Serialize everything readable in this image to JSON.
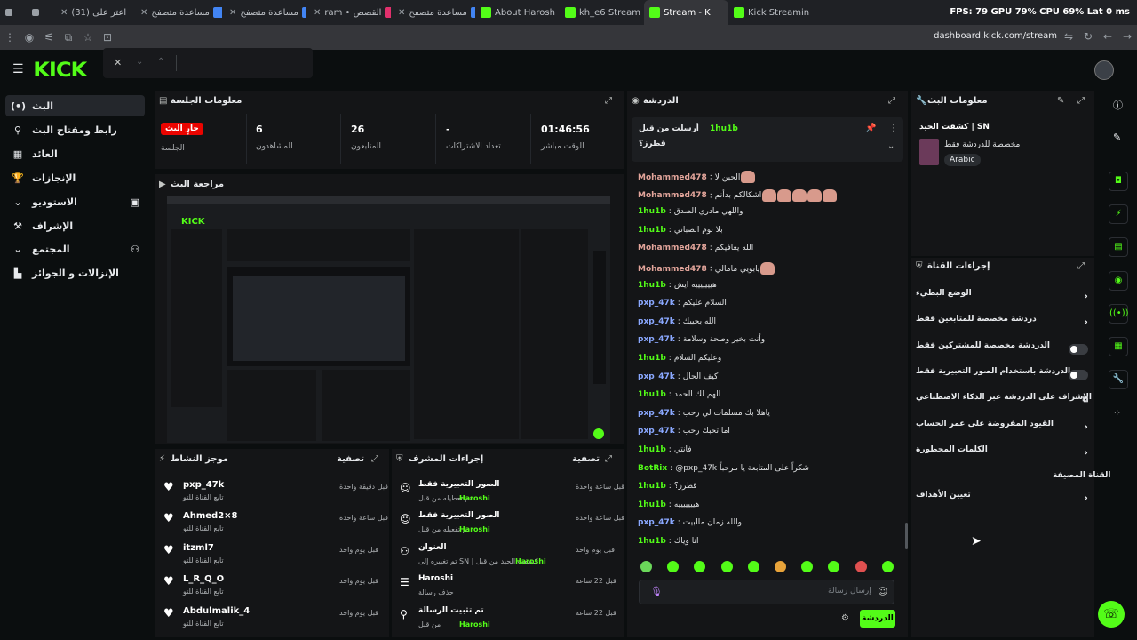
{
  "browser": {
    "tabs": [
      {
        "label": "",
        "icon": "#9aa0a6"
      },
      {
        "label": "",
        "icon": "#9aa0a6"
      },
      {
        "label": "(31) اعتر على",
        "icon": "#9aa0a6"
      },
      {
        "label": "مساعدة متصفح",
        "icon": "#4285f4"
      },
      {
        "label": "مساعدة متصفح",
        "icon": "#4285f4"
      },
      {
        "label": "ram • القصص",
        "icon": "#e1306c"
      },
      {
        "label": "مساعدة متصفح",
        "icon": "#4285f4"
      },
      {
        "label": "About Harosh",
        "icon": "#53fc18"
      },
      {
        "label": "kh_e6 Stream",
        "icon": "#53fc18"
      },
      {
        "label": "Stream - K",
        "icon": "#53fc18"
      },
      {
        "label": "Kick Streamin",
        "icon": "#53fc18"
      }
    ],
    "overlay": "FPS: 79  GPU 79%  CPU 69%  Lat 0 ms",
    "url": "dashboard.kick.com/stream"
  },
  "logo": "KICK",
  "sidebar": {
    "items": [
      {
        "label": "البث",
        "icon": "(•)"
      },
      {
        "label": "رابط ومفتاح البث",
        "icon": "⚲"
      },
      {
        "label": "العائد",
        "icon": "▦"
      },
      {
        "label": "الإنجازات",
        "icon": "🏆"
      },
      {
        "label": "الاستوديو",
        "icon": "⌄"
      },
      {
        "label": "الإشراف",
        "icon": "⚒"
      },
      {
        "label": "المجتمع",
        "icon": "⌄"
      },
      {
        "label": "الإنزالات و الجوائز",
        "icon": "▙"
      }
    ]
  },
  "session": {
    "title": "معلومات الجلسة",
    "live_badge": "جارٍ البث",
    "live_label": "الجلسة",
    "stats": [
      {
        "value": "6",
        "label": "المشاهدون"
      },
      {
        "value": "26",
        "label": "المتابعون"
      },
      {
        "value": "-",
        "label": "تعداد الاشتراكات"
      },
      {
        "value": "01:46:56",
        "label": "الوقت مباشر"
      }
    ]
  },
  "preview": {
    "title": "مراجعة البث"
  },
  "activity": {
    "title": "موجز النشاط",
    "filter": "تصفية",
    "items": [
      {
        "name": "pxp_47k",
        "sub": "تابع القناة للتو",
        "time": "قبل دقيقة واحدة"
      },
      {
        "name": "Ahmed2×8",
        "sub": "تابع القناة للتو",
        "time": "قبل ساعة واحدة"
      },
      {
        "name": "itzml7",
        "sub": "تابع القناة للتو",
        "time": "قبل يوم واحد"
      },
      {
        "name": "L_R_Q_O",
        "sub": "تابع القناة للتو",
        "time": "قبل يوم واحد"
      },
      {
        "name": "Abdulmalik_4",
        "sub": "تابع القناة للتو",
        "time": "قبل يوم واحد"
      }
    ]
  },
  "modactions": {
    "title": "إجراءات المشرف",
    "filter": "تصفية",
    "items": [
      {
        "name": "الصور التعبيرية فقط",
        "sub": "تم تعطيله من قبل",
        "user": "Haroshi",
        "time": "قبل ساعة واحدة"
      },
      {
        "name": "الصور التعبيرية فقط",
        "sub": "تم تفعيله من قبل",
        "user": "Haroshi",
        "time": "قبل ساعة واحدة"
      },
      {
        "name": "العنوان",
        "sub": "تم تغييره إلى SN | كشفت الحيد من قبل",
        "user": "Haroshi",
        "time": "قبل يوم واحد"
      },
      {
        "name": "Haroshi",
        "sub": "حذف رسالة",
        "user": "",
        "time": "قبل 22 ساعة"
      },
      {
        "name": "تم تثبيت الرسالة",
        "sub": "من قبل",
        "user": "Haroshi",
        "time": "قبل 22 ساعة"
      }
    ]
  },
  "chat": {
    "title": "الدردشة",
    "pinned_by": "أرسلت من قبل",
    "pinned_user": "1hu1b",
    "pinned_text": "قطرز؟",
    "messages": [
      {
        "user": "Mohammed478",
        "color": "#e3a59b",
        "text": "الحين لا",
        "emotes": 1
      },
      {
        "user": "Mohammed478",
        "color": "#e3a59b",
        "text": "اشكالكم بدأنم",
        "emotes": 5
      },
      {
        "user": "1hu1b",
        "color": "#53fc18",
        "text": "واللهي مادري الصدق",
        "emotes": 0
      },
      {
        "user": "1hu1b",
        "color": "#53fc18",
        "text": "بلا نوم الصباني",
        "emotes": 0
      },
      {
        "user": "Mohammed478",
        "color": "#e3a59b",
        "text": "الله يعافيكم",
        "emotes": 0
      },
      {
        "user": "Mohammed478",
        "color": "#e3a59b",
        "text": "يابويي مامالي",
        "emotes": 1
      },
      {
        "user": "1hu1b",
        "color": "#53fc18",
        "text": "هيييييييه ايش",
        "emotes": 0
      },
      {
        "user": "pxp_47k",
        "color": "#8aa8ff",
        "text": "السلام عليكم",
        "emotes": 0
      },
      {
        "user": "pxp_47k",
        "color": "#8aa8ff",
        "text": "الله يحييك",
        "emotes": 0
      },
      {
        "user": "pxp_47k",
        "color": "#8aa8ff",
        "text": "وأنت بخير وصحة وسلامة",
        "emotes": 0
      },
      {
        "user": "1hu1b",
        "color": "#53fc18",
        "text": "وعليكم السلام",
        "emotes": 0
      },
      {
        "user": "pxp_47k",
        "color": "#8aa8ff",
        "text": "كيف الحال",
        "emotes": 0
      },
      {
        "user": "1hu1b",
        "color": "#53fc18",
        "text": "الهم لك الحمد",
        "emotes": 0
      },
      {
        "user": "pxp_47k",
        "color": "#8aa8ff",
        "text": "ياهلا بك مسلمات لي رحب",
        "emotes": 0
      },
      {
        "user": "pxp_47k",
        "color": "#8aa8ff",
        "text": "اما تحبك رحب",
        "emotes": 0
      },
      {
        "user": "1hu1b",
        "color": "#53fc18",
        "text": "فانتي",
        "emotes": 0
      },
      {
        "user": "BotRix",
        "color": "#53fc18",
        "text": "@pxp_47k شكراً على المتابعة يا مرحباً",
        "emotes": 0
      },
      {
        "user": "1hu1b",
        "color": "#53fc18",
        "text": "قطرز؟",
        "emotes": 0
      },
      {
        "user": "1hu1b",
        "color": "#53fc18",
        "text": "هيييييييه",
        "emotes": 0
      },
      {
        "user": "pxp_47k",
        "color": "#8aa8ff",
        "text": "والله زمان مالبيت",
        "emotes": 0
      },
      {
        "user": "1hu1b",
        "color": "#53fc18",
        "text": "انا وياك",
        "emotes": 0
      }
    ],
    "input_placeholder": "إرسال رسالة",
    "send_label": "الدردشة"
  },
  "streaminfo": {
    "title": "معلومات البث",
    "stream_title": "كشفت الحيد | SN",
    "category": "مخصصة للدردشة فقط",
    "language": "Arabic"
  },
  "channel": {
    "title": "إجراءات القناة",
    "rows": [
      {
        "label": "الوضع البطيء",
        "kind": "chevron"
      },
      {
        "label": "دردشة مخصصة للمتابعين فقط",
        "kind": "chevron"
      },
      {
        "label": "الدردشة مخصصة للمشتركين فقط",
        "kind": "toggle"
      },
      {
        "label": "الدردشة باستخدام الصور التعبيرية فقط",
        "kind": "toggle"
      },
      {
        "label": "الإشراف على الدردشة عبر الذكاء الاصطناعي",
        "kind": "external"
      },
      {
        "label": "القيود المفروضة على عمر الحساب",
        "kind": "chevron"
      },
      {
        "label": "الكلمات المحظورة",
        "kind": "chevron"
      }
    ],
    "section": "القناة المضيفة",
    "hosting_row": "تعيين الأهداف"
  }
}
